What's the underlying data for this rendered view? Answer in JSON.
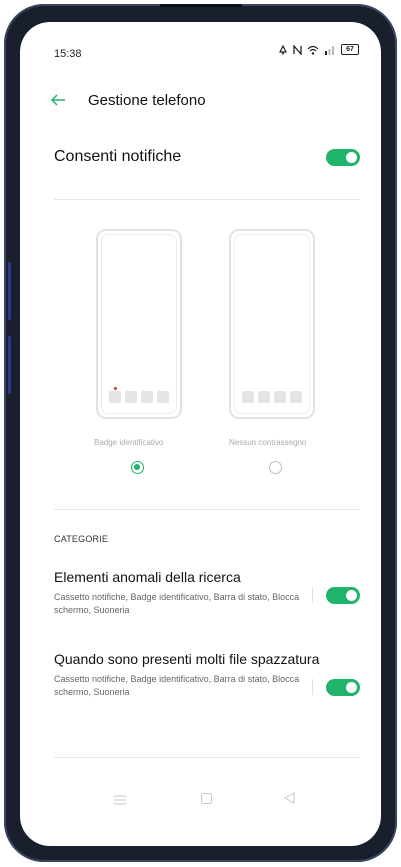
{
  "status_bar": {
    "time": "15:38",
    "battery": "67",
    "icons": [
      "alarm-icon",
      "nfc-icon",
      "wifi-icon",
      "signal-icon",
      "battery-icon"
    ]
  },
  "header": {
    "title": "Gestione telefono",
    "back_icon": "arrow-left-icon"
  },
  "notifications": {
    "label": "Consenti notifiche",
    "enabled": true
  },
  "badge_options": [
    {
      "label": "Badge identificativo",
      "selected": true
    },
    {
      "label": "Nessun contrassegno",
      "selected": false
    }
  ],
  "categories": {
    "header": "CATEGORIE",
    "items": [
      {
        "title": "Elementi anomali della ricerca",
        "description": "Cassetto notifiche, Badge identificativo, Barra di stato, Blocca schermo, Suoneria",
        "enabled": true
      },
      {
        "title": "Quando sono presenti molti file spazzatura",
        "description": "Cassetto notifiche, Badge identificativo, Barra di stato, Blocca schermo, Suoneria",
        "enabled": true
      }
    ]
  },
  "nav_bar": [
    "menu-icon",
    "home-icon",
    "back-triangle-icon"
  ],
  "colors": {
    "accent": "#1fb36b",
    "frame": "#1a1f2e",
    "side_keys": "#2a3a8a"
  }
}
